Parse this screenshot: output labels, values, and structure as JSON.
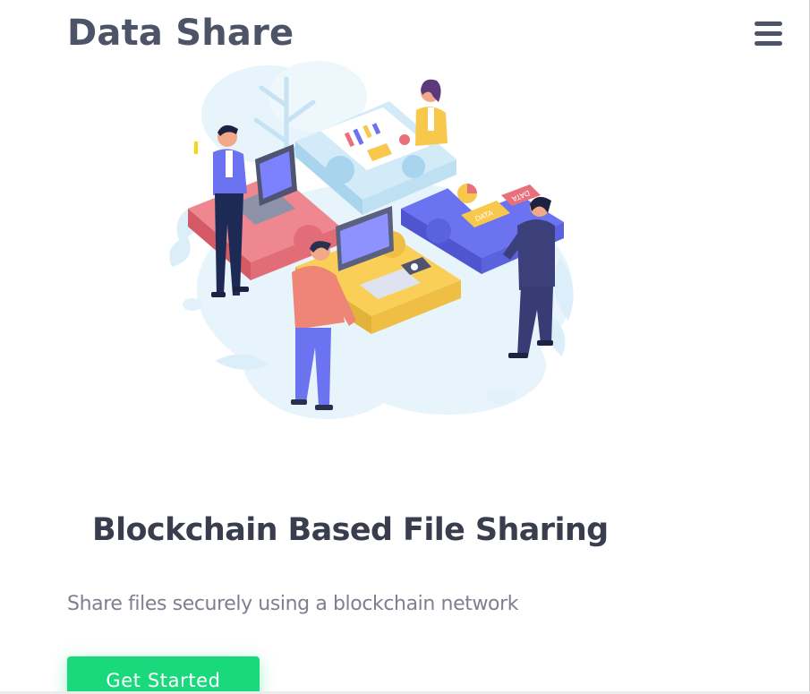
{
  "navbar": {
    "brand": "Data Share",
    "menu_icon": "hamburger-menu-icon"
  },
  "hero": {
    "illustration_icon": "puzzle-collaboration-illustration",
    "illustration_labels": {
      "data_tag_1": "DATA",
      "data_tag_2": "DATA"
    },
    "title": "Blockchain Based File Sharing",
    "subtitle": "Share files securely using a blockchain network",
    "cta_label": "Get Started"
  },
  "colors": {
    "brand_text": "#4e5468",
    "title_text": "#3a3d4d",
    "subtitle_text": "#7d808e",
    "cta_background": "#1ad97c",
    "puzzle_red": "#e9707a",
    "puzzle_blue": "#6b73f0",
    "puzzle_yellow": "#f7c84b",
    "puzzle_light_blue": "#c9e6f6",
    "backdrop": "#e8f4fb"
  }
}
